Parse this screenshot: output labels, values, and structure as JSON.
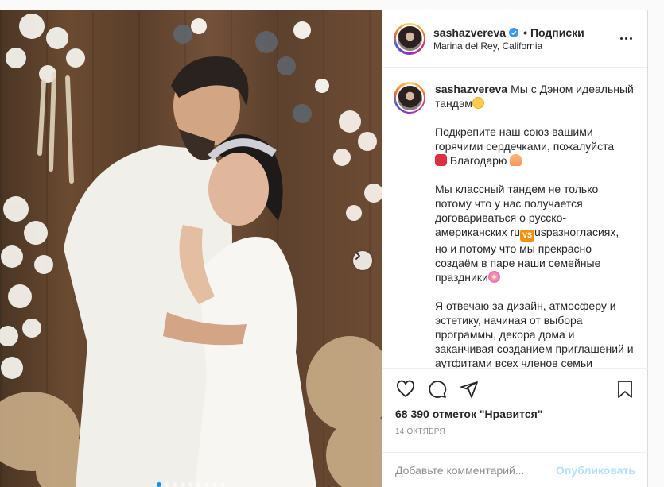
{
  "post": {
    "username": "sashazvereva",
    "separator": "•",
    "follow_label": "Подписки",
    "location": "Marina del Rey, California",
    "caption": {
      "p1": "Мы с Дэном идеальный тандэм",
      "p2": "Подкрепите наш союз вашими горячими сердечками, пожалуйста",
      "p2b": " Благодарю ",
      "p3a": "Мы классный тандем не только потому что у нас получается договариваться о русско-американских ru",
      "vs": "VS",
      "p3b": "usразногласиях, но и потому что мы прекрасно создаём в паре наши семейные праздники",
      "p4": "Я отвечаю за дизайн, атмосферу и эстетику, начиная от выбора программы, декора дома и заканчивая созданием приглашений и аутфитами всех членов семьи"
    },
    "likes_text": "68 390 отметок \"Нравится\"",
    "date": "14 октября",
    "comment_placeholder": "Добавьте комментарий...",
    "publish_label": "Опубликовать",
    "carousel": {
      "slides": 9,
      "active_index": 0
    }
  },
  "icons": [
    "heart-icon",
    "comment-icon",
    "share-icon",
    "bookmark-icon",
    "more-icon",
    "verified-badge-icon",
    "chevron-right-icon"
  ],
  "colors": {
    "accent": "#0095f6",
    "publish_disabled": "#b2dffc",
    "muted": "#8e8e8e",
    "text": "#262626"
  }
}
